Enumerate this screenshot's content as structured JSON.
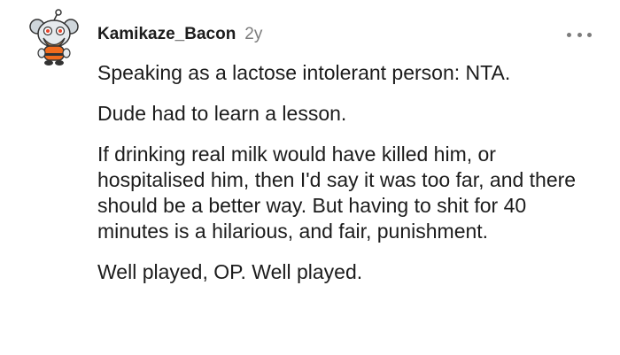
{
  "comment": {
    "avatar_icon": "snoo-avatar-icon",
    "username": "Kamikaze_Bacon",
    "timestamp": "2y",
    "more_icon": "more-options-icon",
    "paragraphs": [
      "Speaking as a lactose intolerant person: NTA.",
      "Dude had to learn a lesson.",
      "If drinking real milk would have killed him, or hospitalised him, then I'd say it was too far, and there should be a better way. But having to shit for 40 minutes is a hilarious, and fair, punishment.",
      "Well played, OP. Well played."
    ]
  },
  "colors": {
    "text": "#1c1c1c",
    "meta": "#7c7c7c",
    "background": "#ffffff"
  }
}
